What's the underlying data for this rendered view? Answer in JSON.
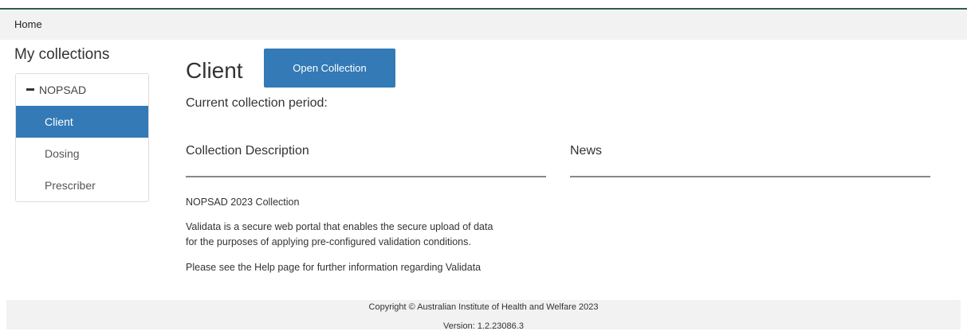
{
  "breadcrumb": {
    "home": "Home"
  },
  "sidebar": {
    "title": "My collections",
    "group": "NOPSAD",
    "items": [
      {
        "label": "Client",
        "active": true
      },
      {
        "label": "Dosing",
        "active": false
      },
      {
        "label": "Prescriber",
        "active": false
      }
    ]
  },
  "main": {
    "title": "Client",
    "open_button": "Open Collection",
    "period_label": "Current collection period:",
    "description_heading": "Collection Description",
    "news_heading": "News",
    "description_name": "NOPSAD 2023 Collection",
    "description_line1": "Validata is a secure web portal that enables the secure upload of data",
    "description_line2": "for the purposes of applying pre-configured validation conditions.",
    "help_text": "Please see the Help page for further information regarding Validata"
  },
  "footer": {
    "copyright": "Copyright © Australian Institute of Health and Welfare 2023",
    "version": "Version: 1.2.23086.3"
  },
  "colors": {
    "accent": "#337ab7",
    "header_line": "#2e5e4e",
    "bar_bg": "#f2f2f2"
  }
}
